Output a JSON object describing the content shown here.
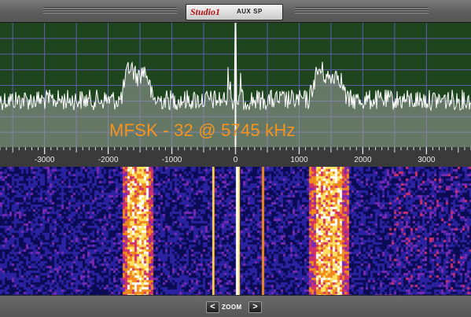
{
  "header": {
    "brand": "Studio1",
    "output_label": "AUX SP"
  },
  "spectrum": {
    "annotation": "MFSK - 32  @ 5745 kHz",
    "colors": {
      "background": "#1e451e",
      "grid": "#5f5fae",
      "trace": "#ffffff",
      "fill": "#a0a0a0",
      "center_marker": "#ffffff"
    },
    "signal_bands_hz": [
      [
        -1800,
        -1300
      ],
      [
        1150,
        1750
      ]
    ],
    "frequency_axis": {
      "range_hz": [
        -3700,
        3700
      ],
      "ticks": [
        {
          "value": -3000,
          "label": "-3000"
        },
        {
          "value": -2000,
          "label": "-2000"
        },
        {
          "value": -1000,
          "label": "-1000"
        },
        {
          "value": 0,
          "label": "0"
        },
        {
          "value": 1000,
          "label": "1000"
        },
        {
          "value": 2000,
          "label": "2000"
        },
        {
          "value": 3000,
          "label": "3000"
        }
      ]
    }
  },
  "waterfall": {
    "palette": [
      "#0b0b55",
      "#2a22a0",
      "#7a2ab4",
      "#d0306a",
      "#f08a1c",
      "#ffe060",
      "#ffffff"
    ]
  },
  "footer": {
    "zoom_out": "<",
    "zoom_label": "ZOOM",
    "zoom_in": ">"
  }
}
